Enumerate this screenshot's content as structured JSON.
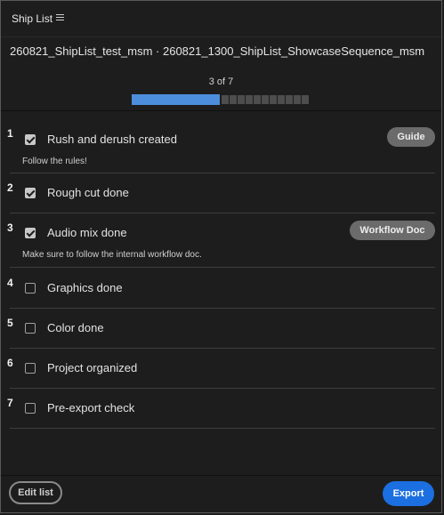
{
  "panel": {
    "title": "Ship List",
    "menu_icon": "hamburger-menu-icon"
  },
  "sequence": {
    "name": "260821_ShipList_test_msm · 260821_1300_ShipList_ShowcaseSequence_msm"
  },
  "progress": {
    "text": "3 of 7",
    "completed": 3,
    "total": 7,
    "fill_fraction": 0.43
  },
  "tasks": [
    {
      "num": "1",
      "label": "Rush and derush created",
      "checked": true,
      "note": "Follow the rules!",
      "button": "Guide"
    },
    {
      "num": "2",
      "label": "Rough cut done",
      "checked": true
    },
    {
      "num": "3",
      "label": "Audio mix done",
      "checked": true,
      "note": "Make sure to follow the internal workflow doc.",
      "button": "Workflow Doc"
    },
    {
      "num": "4",
      "label": "Graphics done",
      "checked": false
    },
    {
      "num": "5",
      "label": "Color done",
      "checked": false
    },
    {
      "num": "6",
      "label": "Project organized",
      "checked": false
    },
    {
      "num": "7",
      "label": "Pre-export check",
      "checked": false
    }
  ],
  "footer": {
    "edit_label": "Edit list",
    "export_label": "Export"
  },
  "colors": {
    "accent": "#1b6fe0",
    "progress_fill": "#4c8edb",
    "background": "#1d1d1d"
  }
}
